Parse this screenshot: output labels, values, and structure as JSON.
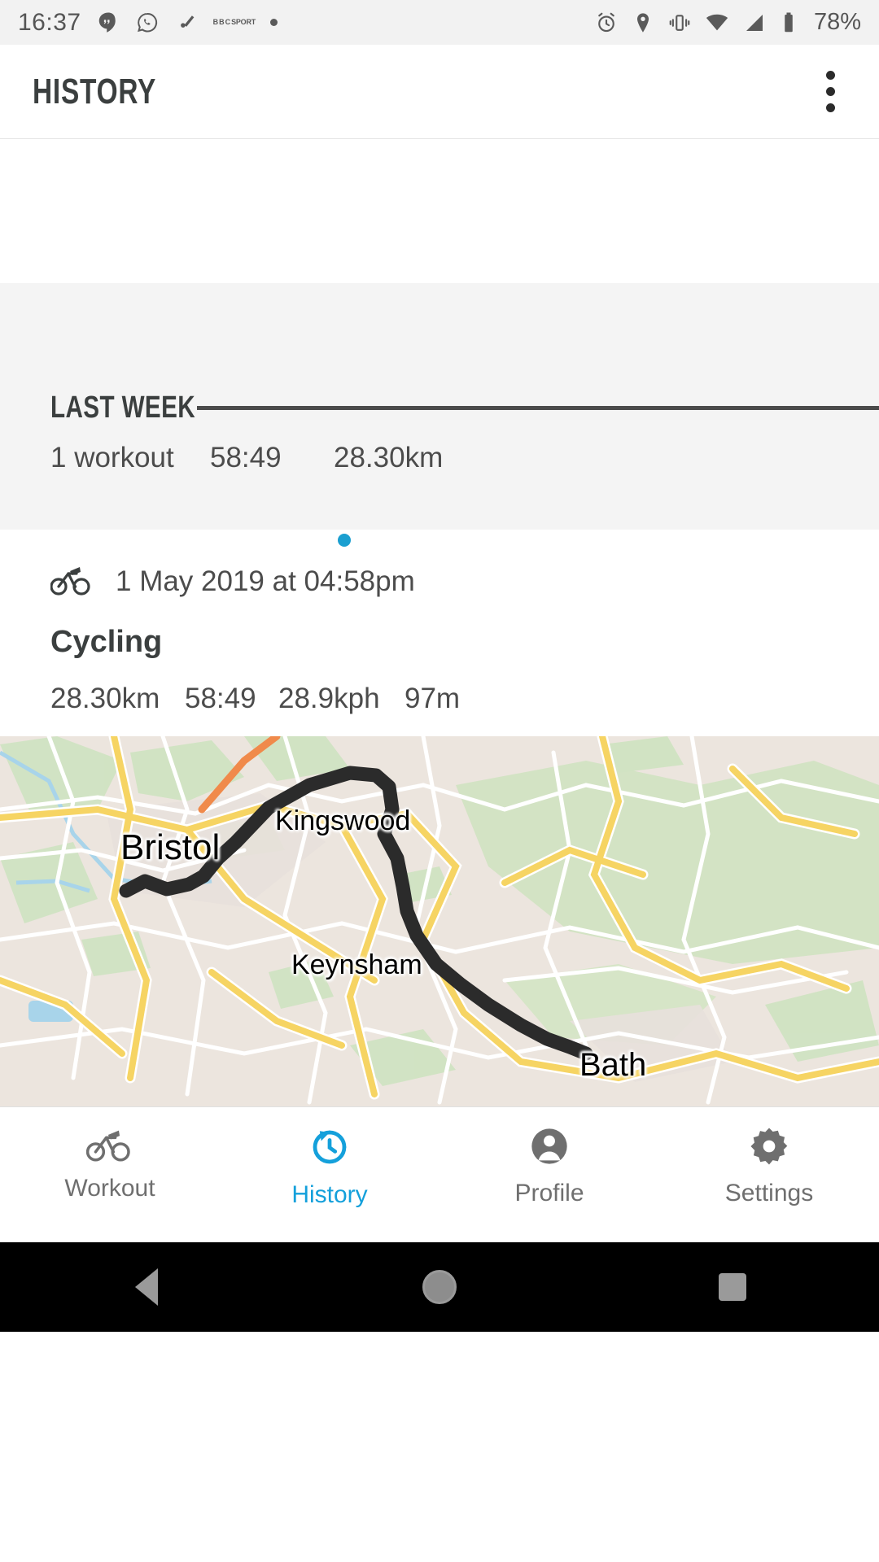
{
  "statusbar": {
    "time": "16:37",
    "battery": "78%",
    "left_icons": [
      "hangouts-icon",
      "whatsapp-icon",
      "edit-pencil-icon",
      "bbc-sport-icon",
      "dot-icon"
    ],
    "bbc_label_top": "BBC",
    "bbc_label_bottom": "SPORT",
    "right_icons": [
      "alarm-icon",
      "location-icon",
      "vibrate-icon",
      "wifi-icon",
      "signal-icon",
      "battery-icon"
    ]
  },
  "appbar": {
    "title": "HISTORY",
    "overflow_icon": "kebab-menu-icon"
  },
  "summary": {
    "title": "LAST WEEK",
    "workouts": "1 workout",
    "duration": "58:49",
    "distance": "28.30km",
    "spark_color": "#1b9fd0"
  },
  "workout": {
    "sport_icon": "cycling-icon",
    "date": "1 May 2019 at 04:58pm",
    "type": "Cycling",
    "distance": "28.30km",
    "duration": "58:49",
    "speed": "28.9kph",
    "ascent": "97m"
  },
  "map": {
    "labels": [
      {
        "name": "Bristol"
      },
      {
        "name": "Kingswood"
      },
      {
        "name": "Keynsham"
      },
      {
        "name": "Bath"
      }
    ],
    "route_color": "#2b2b2b",
    "land_color": "#ece5de"
  },
  "bottomnav": {
    "active": "History",
    "accent": "#14a0db",
    "items": [
      {
        "label": "Workout",
        "icon": "cycling-icon"
      },
      {
        "label": "History",
        "icon": "history-clock-icon"
      },
      {
        "label": "Profile",
        "icon": "person-icon"
      },
      {
        "label": "Settings",
        "icon": "gear-icon"
      }
    ]
  },
  "androidnav": {
    "back": "back-triangle-icon",
    "home": "home-circle-icon",
    "recents": "recents-square-icon"
  }
}
